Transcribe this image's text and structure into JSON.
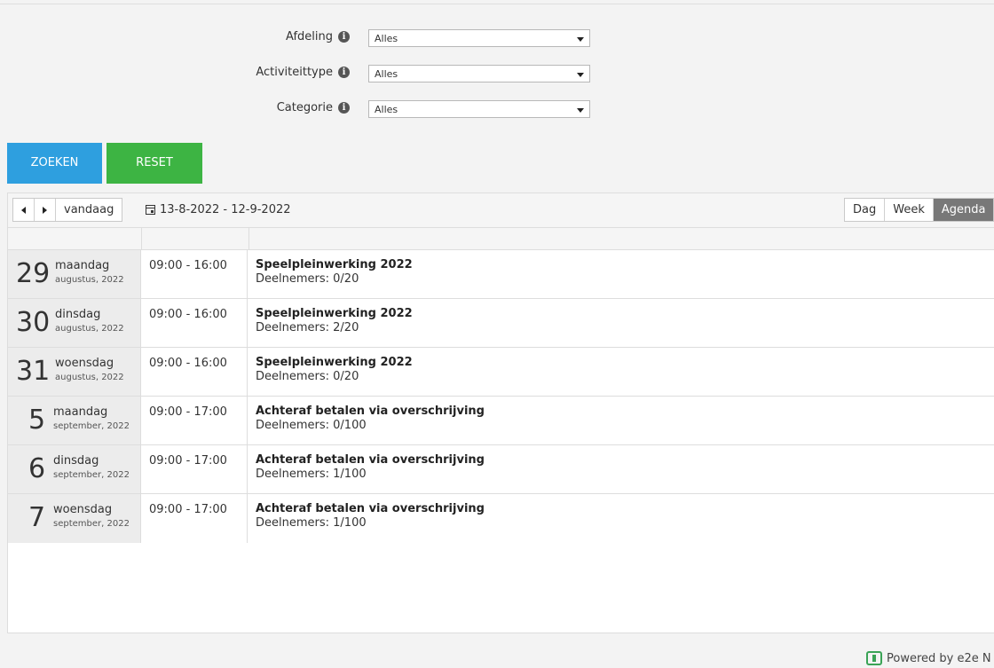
{
  "filters": [
    {
      "label": "Afdeling",
      "value": "Alles"
    },
    {
      "label": "Activiteittype",
      "value": "Alles"
    },
    {
      "label": "Categorie",
      "value": "Alles"
    }
  ],
  "buttons": {
    "search": "ZOEKEN",
    "reset": "RESET"
  },
  "toolbar": {
    "today": "vandaag",
    "date_range": "13-8-2022 - 12-9-2022",
    "views": [
      "Dag",
      "Week",
      "Agenda"
    ],
    "active_view": "Agenda"
  },
  "agenda": [
    {
      "day": "29",
      "weekday": "maandag",
      "month": "augustus, 2022",
      "time": "09:00 - 16:00",
      "title": "Speelpleinwerking 2022",
      "participants": "Deelnemers: 0/20"
    },
    {
      "day": "30",
      "weekday": "dinsdag",
      "month": "augustus, 2022",
      "time": "09:00 - 16:00",
      "title": "Speelpleinwerking 2022",
      "participants": "Deelnemers: 2/20"
    },
    {
      "day": "31",
      "weekday": "woensdag",
      "month": "augustus, 2022",
      "time": "09:00 - 16:00",
      "title": "Speelpleinwerking 2022",
      "participants": "Deelnemers: 0/20"
    },
    {
      "day": "5",
      "weekday": "maandag",
      "month": "september, 2022",
      "time": "09:00 - 17:00",
      "title": "Achteraf betalen via overschrijving",
      "participants": "Deelnemers: 0/100"
    },
    {
      "day": "6",
      "weekday": "dinsdag",
      "month": "september, 2022",
      "time": "09:00 - 17:00",
      "title": "Achteraf betalen via overschrijving",
      "participants": "Deelnemers: 1/100"
    },
    {
      "day": "7",
      "weekday": "woensdag",
      "month": "september, 2022",
      "time": "09:00 - 17:00",
      "title": "Achteraf betalen via overschrijving",
      "participants": "Deelnemers: 1/100"
    }
  ],
  "footer": {
    "powered": "Powered by e2e N"
  },
  "colors": {
    "search": "#2e9fdf",
    "reset": "#3db443",
    "active_view": "#787878"
  }
}
